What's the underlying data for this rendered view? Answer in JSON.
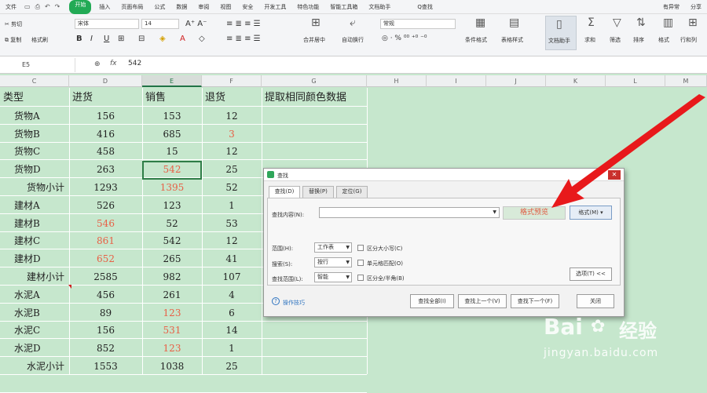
{
  "menu": {
    "file": "文件",
    "tabs": [
      "开始",
      "插入",
      "页面布局",
      "公式",
      "数据",
      "审阅",
      "视图",
      "安全",
      "开发工具",
      "特色功能",
      "智能工具箱",
      "文档助手"
    ],
    "active_tab": "开始",
    "search": "Q查找",
    "right": [
      "有异常",
      "分享"
    ]
  },
  "ribbon": {
    "cut": "剪切",
    "paste": "粘贴",
    "copy": "复制",
    "format_painter": "格式刷",
    "font_name": "宋体",
    "font_size": "14",
    "merge_center": "合并居中",
    "auto_wrap": "自动换行",
    "number_format": "常规",
    "cond_format": "条件格式",
    "table_style": "表格样式",
    "doc_assist": "文档助手",
    "sum": "求和",
    "filter": "筛选",
    "sort": "排序",
    "format": "格式",
    "row_col": "行和列"
  },
  "formula_bar": {
    "cell": "E5",
    "fx": "fx",
    "value": "542"
  },
  "columns": [
    "C",
    "D",
    "E",
    "F",
    "G",
    "H",
    "I",
    "J",
    "K",
    "L",
    "M"
  ],
  "selected_column": "E",
  "headers": [
    "类型",
    "进货",
    "销售",
    "退货",
    "提取相同颜色数据"
  ],
  "rows": [
    {
      "type": "货物A",
      "in": "156",
      "sale": "153",
      "ret": "12",
      "red": []
    },
    {
      "type": "货物B",
      "in": "416",
      "sale": "685",
      "ret": "3",
      "red": [
        "ret"
      ]
    },
    {
      "type": "货物C",
      "in": "458",
      "sale": "15",
      "ret": "12",
      "red": []
    },
    {
      "type": "货物D",
      "in": "263",
      "sale": "542",
      "ret": "25",
      "red": [
        "sale"
      ]
    },
    {
      "type": "货物小计",
      "in": "1293",
      "sale": "1395",
      "ret": "52",
      "red": [
        "sale"
      ],
      "sub": true
    },
    {
      "type": "建材A",
      "in": "526",
      "sale": "123",
      "ret": "1",
      "red": []
    },
    {
      "type": "建材B",
      "in": "546",
      "sale": "52",
      "ret": "53",
      "red": [
        "in"
      ]
    },
    {
      "type": "建材C",
      "in": "861",
      "sale": "542",
      "ret": "12",
      "red": [
        "in"
      ]
    },
    {
      "type": "建材D",
      "in": "652",
      "sale": "265",
      "ret": "41",
      "red": [
        "in"
      ]
    },
    {
      "type": "建材小计",
      "in": "2585",
      "sale": "982",
      "ret": "107",
      "red": [],
      "sub": true
    },
    {
      "type": "水泥A",
      "in": "456",
      "sale": "261",
      "ret": "4",
      "red": []
    },
    {
      "type": "水泥B",
      "in": "89",
      "sale": "123",
      "ret": "6",
      "red": [
        "sale"
      ]
    },
    {
      "type": "水泥C",
      "in": "156",
      "sale": "531",
      "ret": "14",
      "red": [
        "sale"
      ]
    },
    {
      "type": "水泥D",
      "in": "852",
      "sale": "123",
      "ret": "1",
      "red": [
        "sale"
      ]
    },
    {
      "type": "水泥小计",
      "in": "1553",
      "sale": "1038",
      "ret": "25",
      "red": [],
      "sub": true
    }
  ],
  "dialog": {
    "title": "查找",
    "tabs": [
      "查找(D)",
      "替换(P)",
      "定位(G)"
    ],
    "find_label": "查找内容(N):",
    "format_preview": "格式预览",
    "format_button": "格式(M)",
    "scope_label": "范围(H):",
    "scope_value": "工作表",
    "search_label": "搜索(S):",
    "search_value": "按行",
    "lookin_label": "查找范围(L):",
    "lookin_value": "智能",
    "opt_case": "区分大小写(C)",
    "opt_cell": "单元格匹配(O)",
    "opt_width": "区分全/半角(B)",
    "options_button": "选项(T) <<",
    "tips": "操作技巧",
    "find_all": "查找全部(I)",
    "find_prev": "查找上一个(V)",
    "find_next": "查找下一个(F)",
    "close": "关闭"
  },
  "watermark": {
    "brand": "Bai",
    "brand2": "经验",
    "url": "jingyan.baidu.com"
  },
  "colors": {
    "sheet_bg": "#c6e7cd",
    "red_text": "#e86046",
    "accent": "#22aa55",
    "arrow": "#e8191b"
  }
}
